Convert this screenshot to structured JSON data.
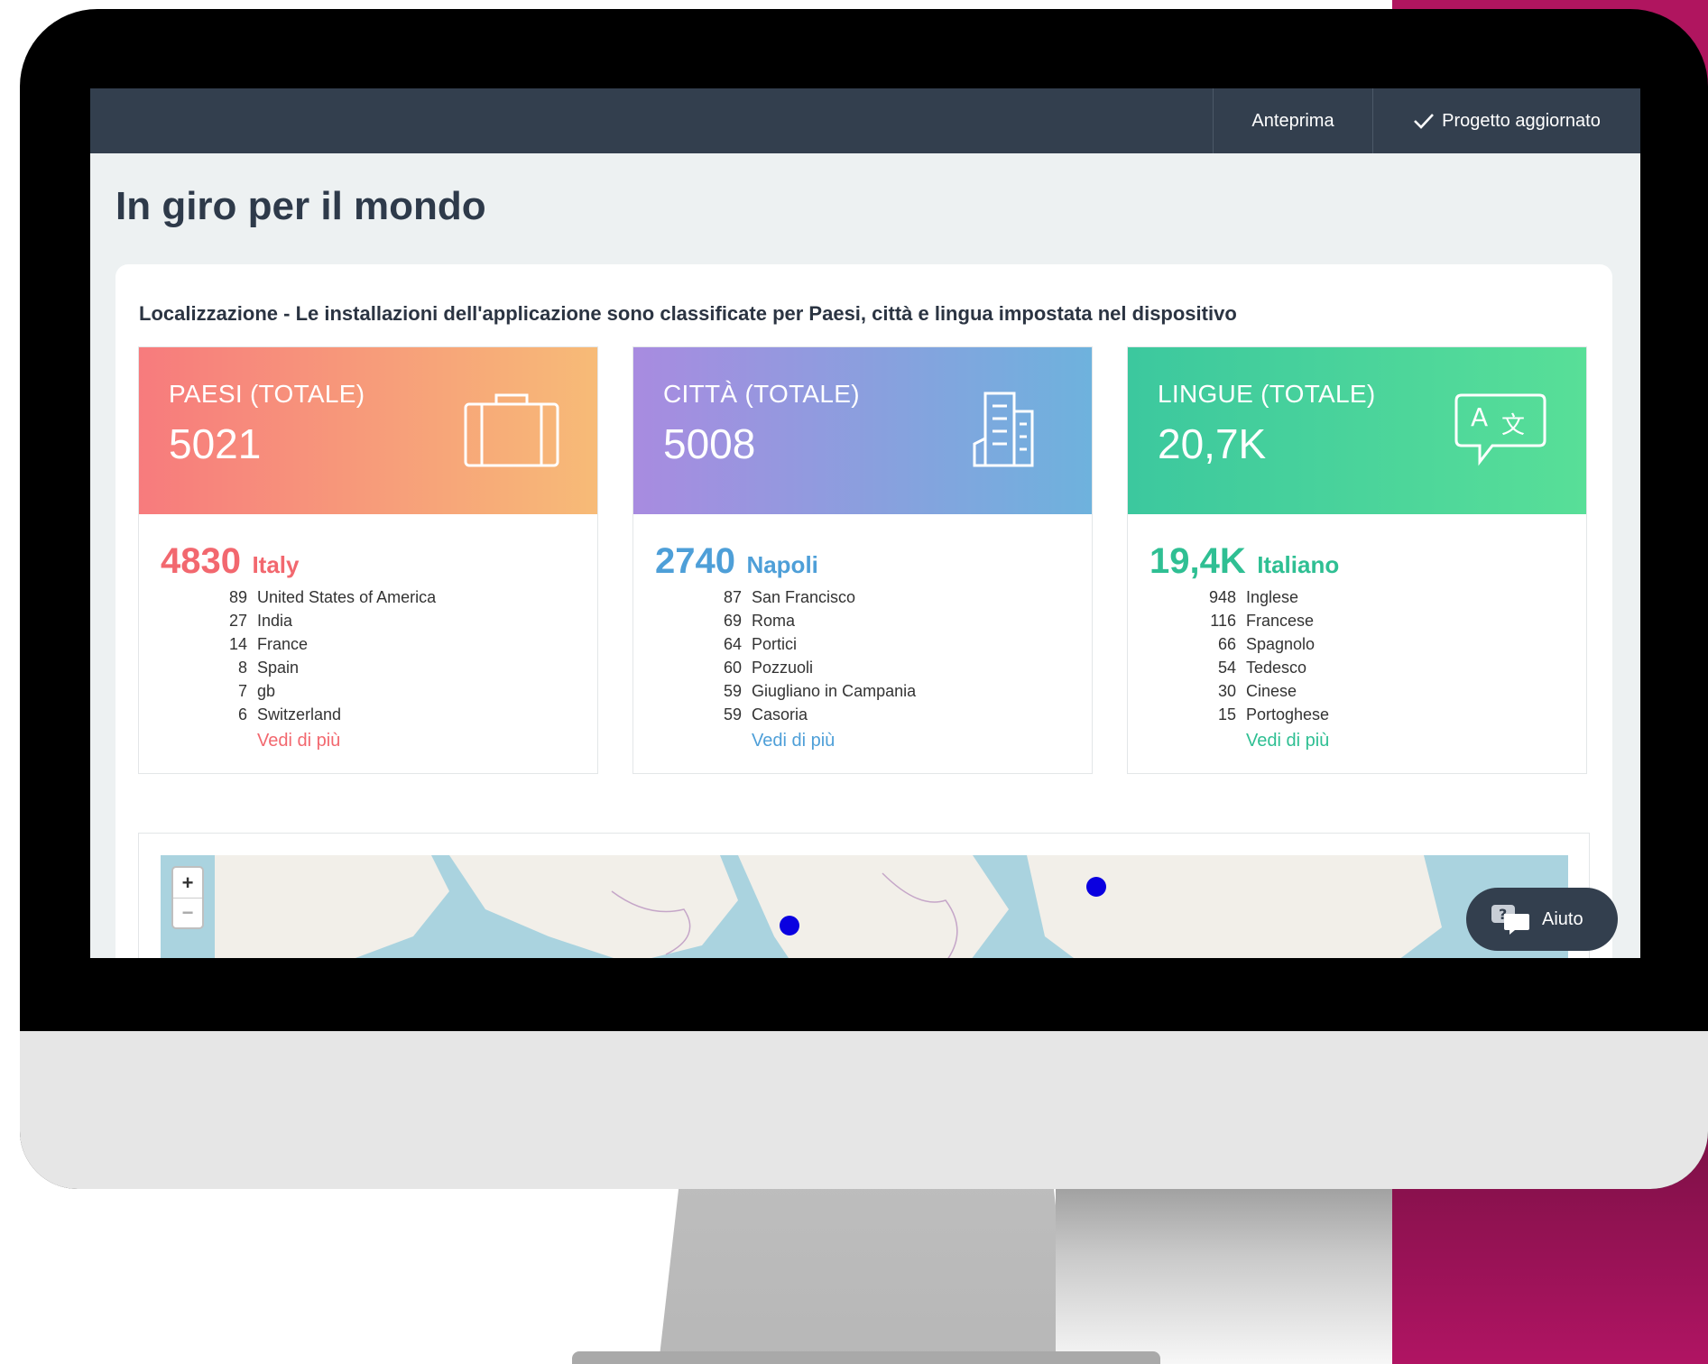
{
  "header": {
    "preview_label": "Anteprima",
    "saved_label": "Progetto aggiornato"
  },
  "page": {
    "title": "In giro per il mondo",
    "description": "Localizzazione - Le installazioni dell'applicazione sono classificate per Paesi, città e lingua impostata nel dispositivo"
  },
  "cards": {
    "countries": {
      "label": "PAESI (TOTALE)",
      "total": "5021",
      "top_value": "4830",
      "top_name": "Italy",
      "rows": [
        {
          "n": "89",
          "t": "United States of America"
        },
        {
          "n": "27",
          "t": "India"
        },
        {
          "n": "14",
          "t": "France"
        },
        {
          "n": "8",
          "t": "Spain"
        },
        {
          "n": "7",
          "t": "gb"
        },
        {
          "n": "6",
          "t": "Switzerland"
        }
      ],
      "more": "Vedi di più",
      "color": "#f2686f"
    },
    "cities": {
      "label": "CITTÀ (TOTALE)",
      "total": "5008",
      "top_value": "2740",
      "top_name": "Napoli",
      "rows": [
        {
          "n": "87",
          "t": "San Francisco"
        },
        {
          "n": "69",
          "t": "Roma"
        },
        {
          "n": "64",
          "t": "Portici"
        },
        {
          "n": "60",
          "t": "Pozzuoli"
        },
        {
          "n": "59",
          "t": "Giugliano in Campania"
        },
        {
          "n": "59",
          "t": "Casoria"
        }
      ],
      "more": "Vedi di più",
      "color": "#4e9fd8"
    },
    "languages": {
      "label": "LINGUE (TOTALE)",
      "total": "20,7K",
      "top_value": "19,4K",
      "top_name": "Italiano",
      "rows": [
        {
          "n": "948",
          "t": "Inglese"
        },
        {
          "n": "116",
          "t": "Francese"
        },
        {
          "n": "66",
          "t": "Spagnolo"
        },
        {
          "n": "54",
          "t": "Tedesco"
        },
        {
          "n": "30",
          "t": "Cinese"
        },
        {
          "n": "15",
          "t": "Portoghese"
        }
      ],
      "more": "Vedi di più",
      "color": "#2fbf93"
    }
  },
  "map": {
    "zoom_in": "+",
    "zoom_out": "−"
  },
  "help": {
    "label": "Aiuto"
  }
}
